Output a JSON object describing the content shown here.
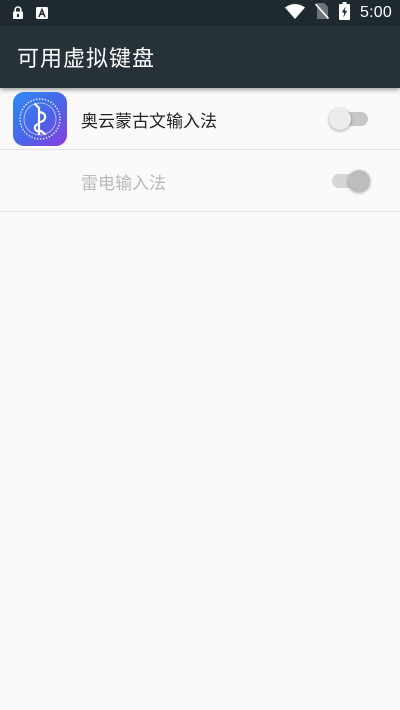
{
  "status_bar": {
    "time": "5:00",
    "icons": [
      "lock-icon",
      "keyboard-a-icon",
      "wifi-icon",
      "no-sim-icon",
      "battery-charging-icon"
    ]
  },
  "app_bar": {
    "title": "可用虚拟键盘"
  },
  "input_methods": [
    {
      "label": "奥云蒙古文输入法",
      "icon": "mongolian-ime-app-icon",
      "enabled": false,
      "disabled_row": false
    },
    {
      "label": "雷电输入法",
      "enabled": true,
      "disabled_row": true
    }
  ],
  "colors": {
    "status_bar": "#1f2a30",
    "app_bar": "#263238",
    "background": "#fafafa"
  }
}
